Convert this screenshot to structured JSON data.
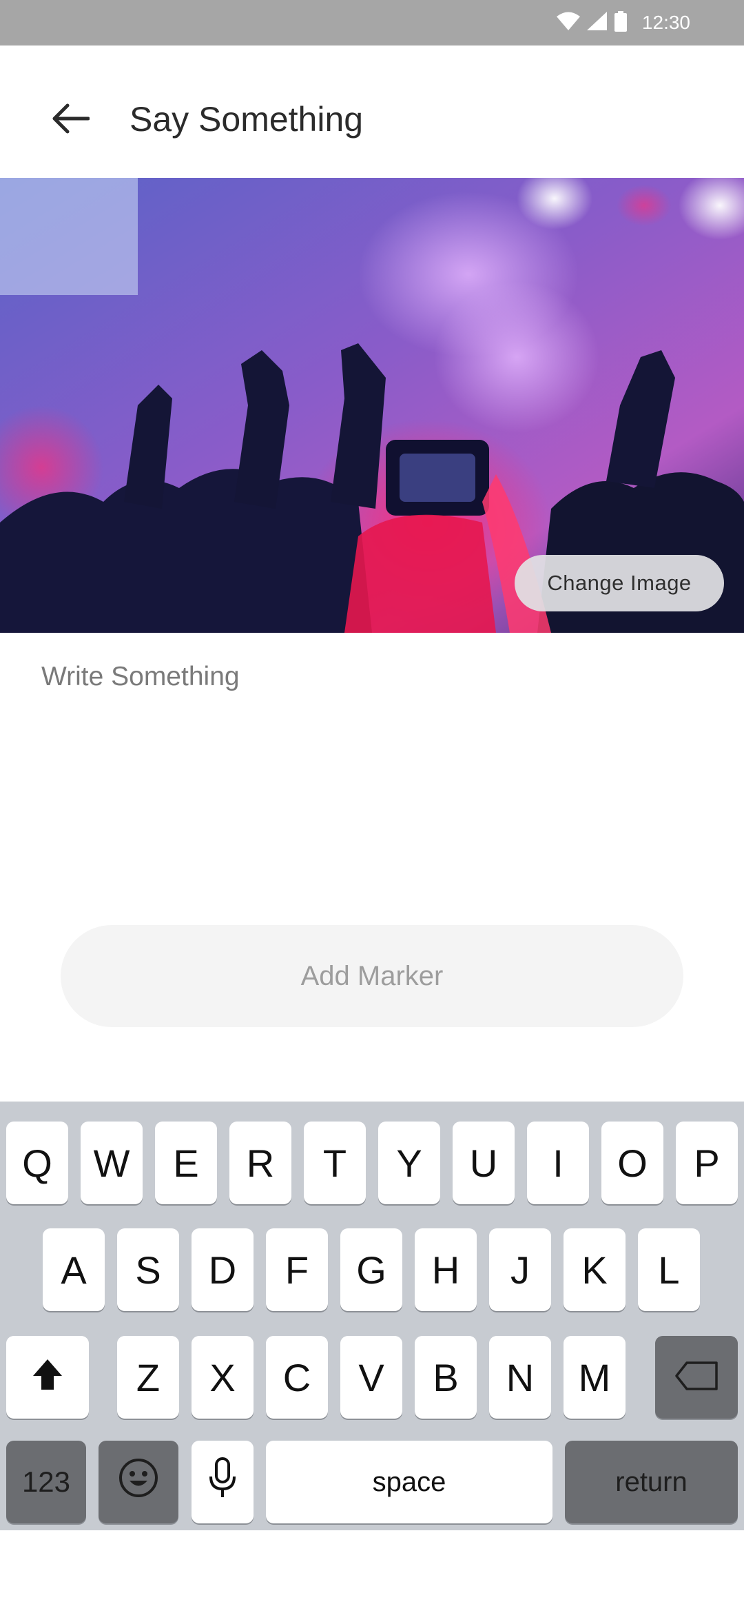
{
  "status_bar": {
    "time": "12:30"
  },
  "header": {
    "title": "Say Something"
  },
  "hero": {
    "change_image_label": "Change Image"
  },
  "compose": {
    "placeholder": "Write Something"
  },
  "actions": {
    "add_marker_label": "Add Marker"
  },
  "keyboard": {
    "row1": [
      "Q",
      "W",
      "E",
      "R",
      "T",
      "Y",
      "U",
      "I",
      "O",
      "P"
    ],
    "row2": [
      "A",
      "S",
      "D",
      "F",
      "G",
      "H",
      "J",
      "K",
      "L"
    ],
    "row3": [
      "Z",
      "X",
      "C",
      "V",
      "B",
      "N",
      "M"
    ],
    "numbers_label": "123",
    "space_label": "space",
    "return_label": "return"
  },
  "colors": {
    "status_bar": "#a6a6a6",
    "keyboard_bg": "#c7cbd1",
    "key_dark": "#6b6d71",
    "marker_button_bg": "#f4f4f4"
  }
}
